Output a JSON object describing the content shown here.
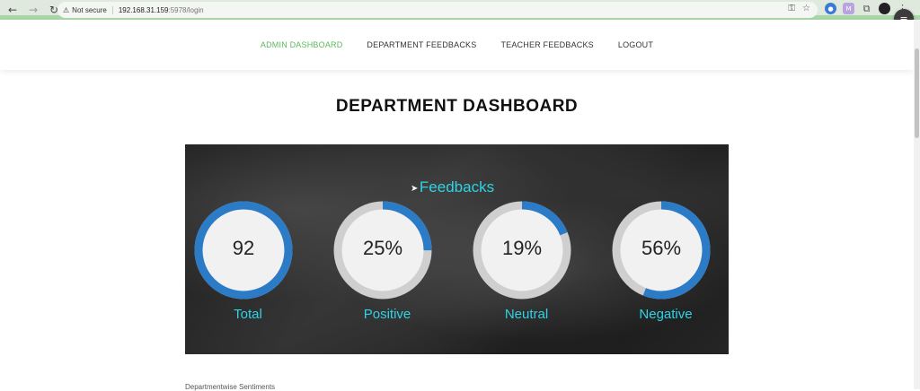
{
  "browser": {
    "security": "Not secure",
    "url_host": "192.168.31.159",
    "url_path": ":5978/login",
    "back_icon": "arrow-left-icon",
    "forward_icon": "arrow-right-icon",
    "reload_icon": "reload-icon"
  },
  "nav": {
    "items": [
      "ADMIN DASHBOARD",
      "DEPARTMENT FEEDBACKS",
      "TEACHER FEEDBACKS",
      "LOGOUT"
    ],
    "active_color": "#5cb85c"
  },
  "page": {
    "title": "DEPARTMENT DASHBOARD",
    "section_label": "Departmentwise Sentiments"
  },
  "hero": {
    "title": "Feedbacks",
    "accent_color": "#2fd3e6",
    "ring_color": "#2b7bc7",
    "track_color": "#cfcfcf"
  },
  "gauges": [
    {
      "value": "92",
      "label": "Total",
      "fraction": 1.0
    },
    {
      "value": "25%",
      "label": "Positive",
      "fraction": 0.25
    },
    {
      "value": "19%",
      "label": "Neutral",
      "fraction": 0.19
    },
    {
      "value": "56%",
      "label": "Negative",
      "fraction": 0.56
    }
  ]
}
